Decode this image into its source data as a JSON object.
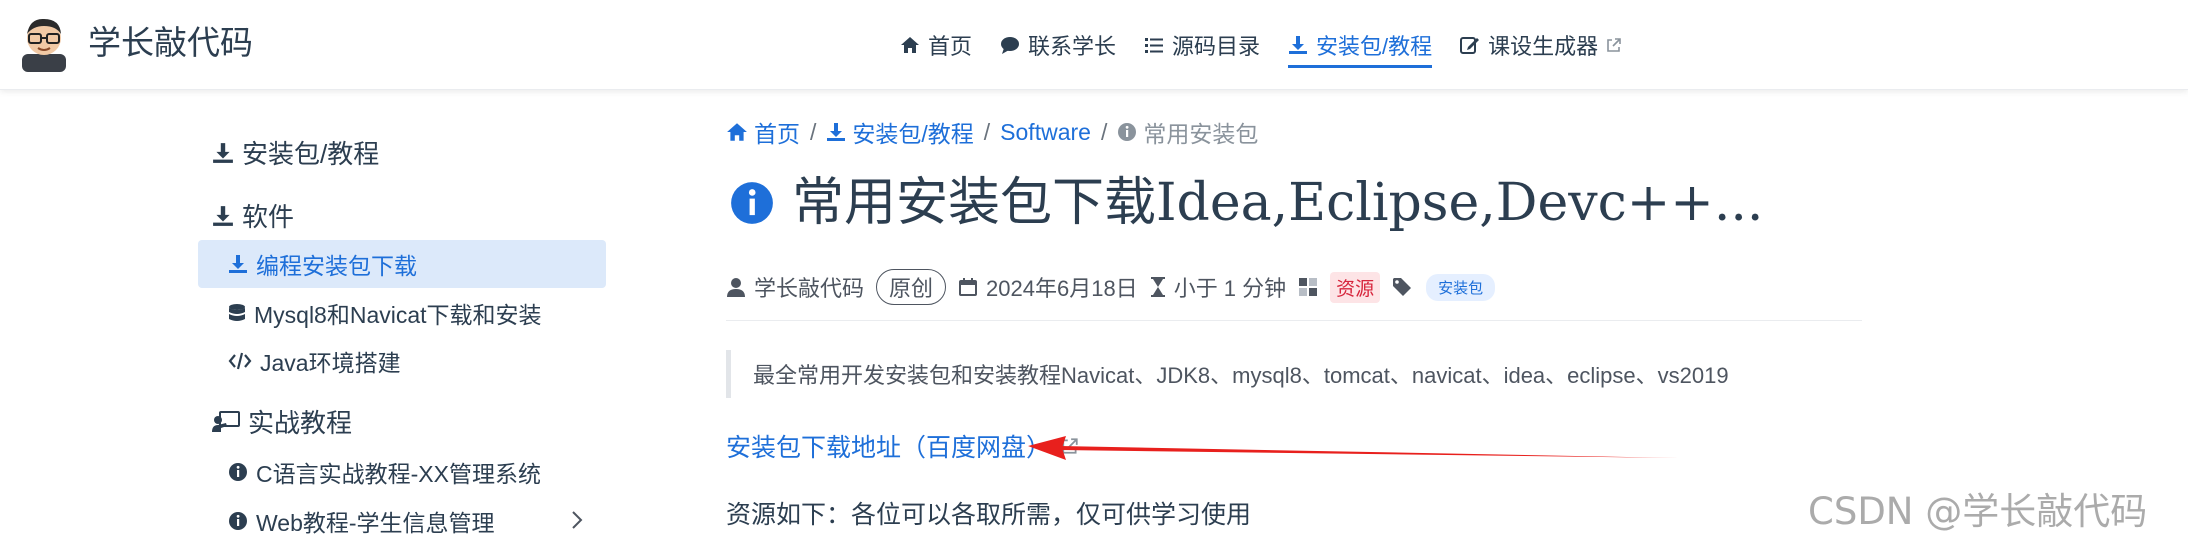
{
  "site": {
    "name": "学长敲代码"
  },
  "nav": {
    "items": [
      {
        "label": "首页",
        "icon": "home-icon"
      },
      {
        "label": "联系学长",
        "icon": "chat-icon"
      },
      {
        "label": "源码目录",
        "icon": "list-icon"
      },
      {
        "label": "安装包/教程",
        "icon": "download-icon",
        "active": true
      },
      {
        "label": "课设生成器",
        "icon": "edit-icon"
      }
    ]
  },
  "sidebar": {
    "sections": [
      {
        "label": "安装包/教程",
        "icon": "download-icon"
      },
      {
        "label": "软件",
        "icon": "download-icon"
      },
      {
        "label": "实战教程",
        "icon": "chalkboard-icon"
      }
    ],
    "items": [
      {
        "label": "编程安装包下载",
        "icon": "download-icon",
        "active": true
      },
      {
        "label": "Mysql8和Navicat下载和安装",
        "icon": "database-icon"
      },
      {
        "label": "Java环境搭建",
        "icon": "code-icon"
      },
      {
        "label": "C语言实战教程-XX管理系统",
        "icon": "info-icon"
      },
      {
        "label": "Web教程-学生信息管理",
        "icon": "info-icon"
      }
    ]
  },
  "breadcrumb": {
    "home": "首页",
    "category": "安装包/教程",
    "sub": "Software",
    "current": "常用安装包"
  },
  "article": {
    "title": "常用安装包下载Idea,Eclipse,Devc++...",
    "meta": {
      "author": "学长敲代码",
      "original": "原创",
      "date": "2024年6月18日",
      "reading_time": "小于 1 分钟",
      "category_badge": "资源",
      "tag": "安装包"
    },
    "quote": "最全常用开发安装包和安装教程Navicat、JDK8、mysql8、tomcat、navicat、idea、eclipse、vs2019",
    "download_link": "安装包下载地址（百度网盘）",
    "resource_text": "资源如下：各位可以各取所需，仅可供学习使用"
  },
  "watermark": "CSDN @学长敲代码",
  "colors": {
    "accent": "#1e6fd9",
    "text": "#2c3e50",
    "arrow": "#e8201d"
  }
}
